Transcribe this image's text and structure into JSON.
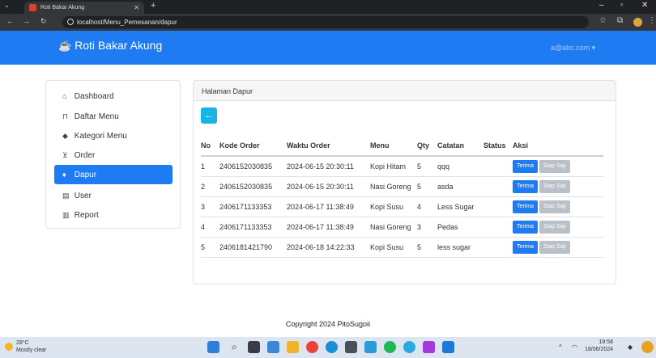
{
  "browser": {
    "tab_title": "Roti Bakar Akung",
    "url": "localhost/Menu_Pemesanan/dapur"
  },
  "navbar": {
    "brand": "Roti Bakar Akung",
    "user": "a@abc.com ▾"
  },
  "sidebar": {
    "items": [
      {
        "label": "Dashboard",
        "icon": "home-icon"
      },
      {
        "label": "Daftar Menu",
        "icon": "book-icon"
      },
      {
        "label": "Kategori Menu",
        "icon": "tag-icon"
      },
      {
        "label": "Order",
        "icon": "cart-icon"
      },
      {
        "label": "Dapur",
        "icon": "fire-icon"
      },
      {
        "label": "User",
        "icon": "user-card-icon"
      },
      {
        "label": "Report",
        "icon": "chart-icon"
      }
    ]
  },
  "main": {
    "title": "Halaman Dapur",
    "back_glyph": "←",
    "columns": [
      "No",
      "Kode Order",
      "Waktu Order",
      "Menu",
      "Qty",
      "Catatan",
      "Status",
      "Aksi"
    ],
    "rows": [
      {
        "no": "1",
        "kode": "2406152030835",
        "waktu": "2024-06-15 20:30:11",
        "menu": "Kopi Hitam",
        "qty": "5",
        "catatan": "qqq",
        "status": ""
      },
      {
        "no": "2",
        "kode": "2406152030835",
        "waktu": "2024-06-15 20:30:11",
        "menu": "Nasi Goreng",
        "qty": "5",
        "catatan": "asda",
        "status": ""
      },
      {
        "no": "3",
        "kode": "2406171133353",
        "waktu": "2024-06-17 11:38:49",
        "menu": "Kopi Susu",
        "qty": "4",
        "catatan": "Less Sugar",
        "status": ""
      },
      {
        "no": "4",
        "kode": "2406171133353",
        "waktu": "2024-06-17 11:38:49",
        "menu": "Nasi Goreng",
        "qty": "3",
        "catatan": "Pedas",
        "status": ""
      },
      {
        "no": "5",
        "kode": "2406181421790",
        "waktu": "2024-06-18 14:22:33",
        "menu": "Kopi Susu",
        "qty": "5",
        "catatan": "less sugar",
        "status": ""
      }
    ],
    "btn_terima": "Terima",
    "btn_siap": "Siap Saji"
  },
  "footer": "Copyright 2024 PitoSugoii",
  "taskbar": {
    "temp": "28°C",
    "weather": "Mostly clear",
    "time": "19:58",
    "date": "18/06/2024"
  },
  "colors": {
    "primary": "#1e7bf2",
    "info": "#19b4e6",
    "muted_button": "#b9c0c7"
  }
}
